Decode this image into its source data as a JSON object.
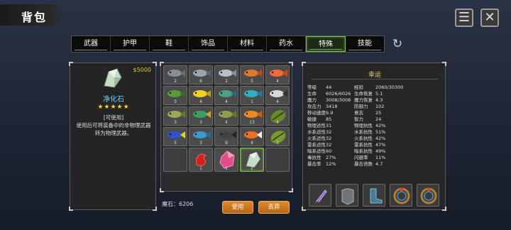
{
  "header": {
    "title": "背包"
  },
  "tabs": [
    {
      "label": "武器",
      "active": false
    },
    {
      "label": "护甲",
      "active": false
    },
    {
      "label": "鞋",
      "active": false
    },
    {
      "label": "饰品",
      "active": false
    },
    {
      "label": "材料",
      "active": false
    },
    {
      "label": "药水",
      "active": false
    },
    {
      "label": "特殊",
      "active": true
    },
    {
      "label": "技能",
      "active": false
    }
  ],
  "detail": {
    "price": "$5000",
    "name": "净化石",
    "stars": "★★★★★",
    "usable": "[可使用]",
    "description": "使用后可将装备中的非物理武器转为物理武器。"
  },
  "inventory": [
    {
      "icon": "fish-gray-icon",
      "qty": "2"
    },
    {
      "icon": "fish-gray-striped-icon",
      "qty": "6"
    },
    {
      "icon": "fish-long-silver-icon",
      "qty": "2"
    },
    {
      "icon": "fish-orange-icon",
      "qty": "5"
    },
    {
      "icon": "fish-orange-small-icon",
      "qty": "4"
    },
    {
      "icon": "fish-green-icon",
      "qty": "3"
    },
    {
      "icon": "fish-yellow-icon",
      "qty": "4"
    },
    {
      "icon": "fish-green-blue-icon",
      "qty": "4"
    },
    {
      "icon": "fish-cyan-icon",
      "qty": "1"
    },
    {
      "icon": "fish-striped-icon",
      "qty": "4"
    },
    {
      "icon": "fish-mackerel-icon",
      "qty": "3"
    },
    {
      "icon": "fish-tropical-icon",
      "qty": "3"
    },
    {
      "icon": "fish-carp-icon",
      "qty": "4"
    },
    {
      "icon": "fish-orange-round-icon",
      "qty": "13"
    },
    {
      "icon": "seed-pod-icon",
      "qty": "4"
    },
    {
      "icon": "fish-blue-tang-icon",
      "qty": "5"
    },
    {
      "icon": "fish-blue-icon",
      "qty": "3"
    },
    {
      "icon": "fish-dark-icon",
      "qty": "9"
    },
    {
      "icon": "fish-clown-icon",
      "qty": "4"
    },
    {
      "icon": "leaf-pod-icon",
      "qty": "3"
    },
    {
      "icon": "",
      "qty": ""
    },
    {
      "icon": "red-rune-icon",
      "qty": "1"
    },
    {
      "icon": "pink-crystal-icon",
      "qty": "1"
    },
    {
      "icon": "purify-stone-icon",
      "qty": "2",
      "selected": true
    },
    {
      "icon": "",
      "qty": ""
    }
  ],
  "footer": {
    "gem_label": "魔石：6206",
    "use_label": "使用",
    "discard_label": "丢弃"
  },
  "stats": {
    "title": "幸运",
    "rows": [
      [
        "等级",
        "44",
        "经验",
        "2060/30300"
      ],
      [
        "生命",
        "6026/6026",
        "生命恢复",
        "5.1"
      ],
      [
        "魔力",
        "3008/3008",
        "魔力恢复",
        "4.3"
      ],
      [
        "攻击力",
        "3418",
        "防御力",
        "102"
      ],
      [
        "移动速度",
        "6.9",
        "意志",
        "25"
      ],
      [
        "敏捷",
        "85",
        "智力",
        "24"
      ],
      [
        "物理适性",
        "31",
        "物理抗性",
        "42%"
      ],
      [
        "水系适性",
        "32",
        "水系抗性",
        "51%"
      ],
      [
        "火系适性",
        "32",
        "火系抗性",
        "42%"
      ],
      [
        "雷系适性",
        "32",
        "雷系抗性",
        "47%"
      ],
      [
        "暗系适性",
        "60",
        "暗系抗性",
        "49%"
      ],
      [
        "毒抗性",
        "27%",
        "闪避率",
        "11%"
      ],
      [
        "暴击率",
        "12%",
        "暴击倍数",
        "4.7"
      ]
    ],
    "equipment": [
      "dagger-icon",
      "armor-icon",
      "boots-icon",
      "ring-icon",
      "ring-icon"
    ]
  },
  "colors": {
    "accent": "#e08a2a",
    "active_tab": "#7ec04a",
    "item_name": "#6fd0ff",
    "price": "#e6c040"
  }
}
